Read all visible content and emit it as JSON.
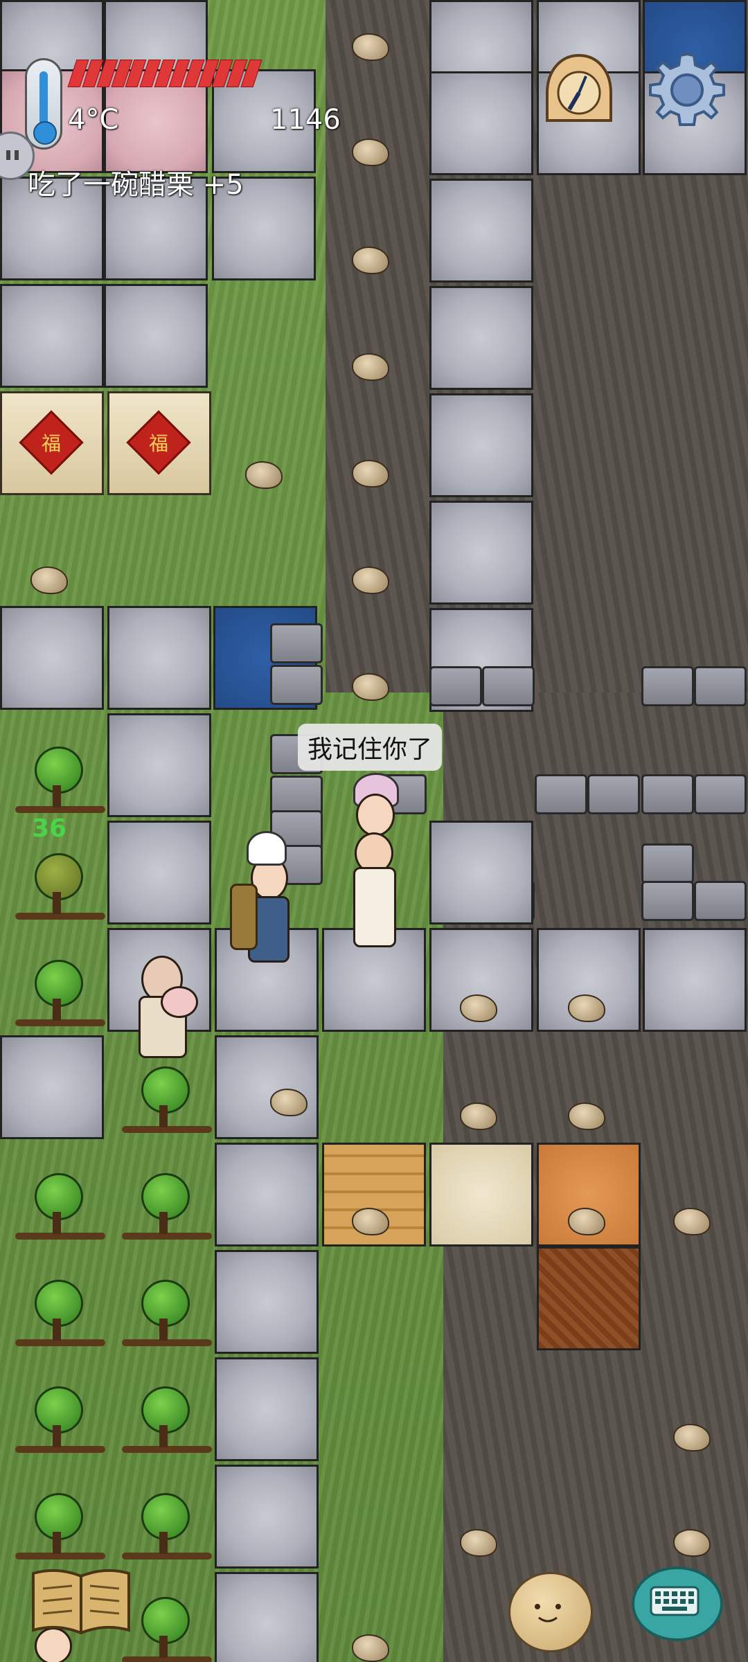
{
  "hud": {
    "temperature": "4°C",
    "score": "1146",
    "message": "吃了一碗醋栗 +5",
    "hunger_segments_filled": 13,
    "hunger_segments_total": 13,
    "colors": {
      "hunger": "#e03838",
      "thermo": "#2f8fd8"
    }
  },
  "world": {
    "speech_bubble": "我记住你了",
    "floating_number": "36",
    "sign_glyph": "福"
  },
  "controls": {
    "clock_icon": "clock-icon",
    "settings_icon": "gear-icon",
    "book_icon": "book-icon",
    "emote_icon": "emote-icon",
    "keyboard_icon": "keyboard-icon"
  }
}
